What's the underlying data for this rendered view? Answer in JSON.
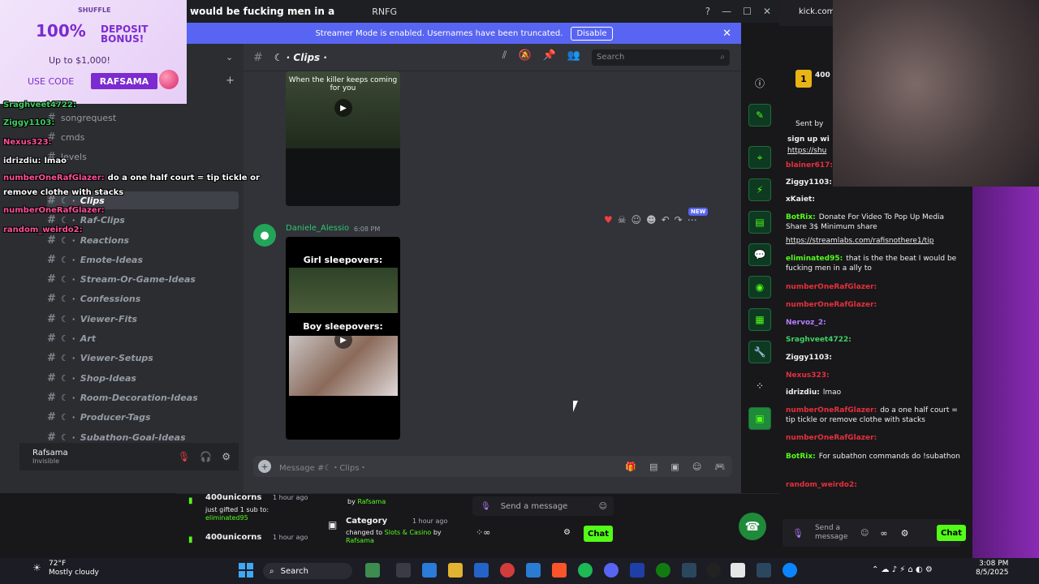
{
  "window": {
    "title": "would be fucking men in a",
    "app_name": "RNFG"
  },
  "banner": {
    "text": "Streamer Mode is enabled. Usernames have been truncated.",
    "disable_label": "Disable"
  },
  "ad": {
    "brand": "SHUFFLE",
    "headline": "100%",
    "headline2": "DEPOSIT BONUS!",
    "upto": "Up to $1,000!",
    "use_code": "USE CODE",
    "code": "RAFSAMA"
  },
  "sidebar": {
    "channels": [
      {
        "name": "songrequest",
        "style": "plain"
      },
      {
        "name": "cmds",
        "style": "plain"
      },
      {
        "name": "levels",
        "style": "plain"
      },
      {
        "name": "Clips",
        "style": "active"
      },
      {
        "name": "Raf-Clips",
        "style": "italic"
      },
      {
        "name": "Reactions",
        "style": "italic"
      },
      {
        "name": "Emote-Ideas",
        "style": "italic"
      },
      {
        "name": "Stream-Or-Game-Ideas",
        "style": "italic"
      },
      {
        "name": "Confessions",
        "style": "italic"
      },
      {
        "name": "Viewer-Fits",
        "style": "italic"
      },
      {
        "name": "Art",
        "style": "italic"
      },
      {
        "name": "Viewer-Setups",
        "style": "italic"
      },
      {
        "name": "Shop-Ideas",
        "style": "italic"
      },
      {
        "name": "Room-Decoration-Ideas",
        "style": "italic"
      },
      {
        "name": "Producer-Tags",
        "style": "italic"
      },
      {
        "name": "Subathon-Goal-Ideas",
        "style": "italic"
      }
    ],
    "user": {
      "name": "Rafsama",
      "status": "Invisible"
    }
  },
  "channel": {
    "name": "Clips",
    "search_placeholder": "Search",
    "composer_placeholder": "Message #☾・Clips・"
  },
  "messages": {
    "video1_caption": "When the killer keeps coming for you",
    "author": "Daniele_Alessio",
    "time": "6:08 PM",
    "video2_label_top": "Girl sleepovers:",
    "video2_label_bottom": "Boy sleepovers:",
    "new_badge": "NEW"
  },
  "overlay_chat": [
    {
      "user": "Sraghveet4722:",
      "text": "",
      "color": "green"
    },
    {
      "user": "Ziggy1103:",
      "text": "",
      "color": "green"
    },
    {
      "user": "Nexus323:",
      "text": "",
      "color": "pink"
    },
    {
      "user": "idrizdiu:",
      "text": "lmao",
      "color": "white"
    },
    {
      "user": "numberOneRafGlazer:",
      "text": "do a one half court = tip tickle or",
      "color": "pink"
    },
    {
      "user": "",
      "text": "remove clothe with stacks",
      "color": "white"
    },
    {
      "user": "numberOneRafGlazer:",
      "text": "",
      "color": "pink"
    },
    {
      "user": "random_weirdo2:",
      "text": "",
      "color": "pink"
    }
  ],
  "kick_chat": [
    {
      "user": "blainer617:",
      "text": "",
      "ucolor": "red"
    },
    {
      "user": "Ziggy1103:",
      "text": "",
      "ucolor": "white"
    },
    {
      "user": "xKaiet:",
      "text": "",
      "ucolor": "white"
    },
    {
      "user": "BotRix:",
      "text": "Donate For Video To Pop Up Media Share 3$ Minimum share",
      "ucolor": "lime"
    },
    {
      "user": "",
      "text": "https://streamlabs.com/rafisnothere1/tip",
      "ucolor": "white"
    },
    {
      "user": "eliminated95:",
      "text": "that is the the beat I would be fucking men in a ally to",
      "ucolor": "lime"
    },
    {
      "user": "numberOneRafGlazer:",
      "text": "",
      "ucolor": "red"
    },
    {
      "user": "numberOneRafGlazer:",
      "text": "",
      "ucolor": "red"
    },
    {
      "user": "Nervoz_2:",
      "text": "",
      "ucolor": "lav"
    },
    {
      "user": "Sraghveet4722:",
      "text": "",
      "ucolor": "green"
    },
    {
      "user": "Ziggy1103:",
      "text": "",
      "ucolor": "white"
    },
    {
      "user": "Nexus323:",
      "text": "",
      "ucolor": "red"
    },
    {
      "user": "idrizdiu:",
      "text": "lmao",
      "ucolor": "white"
    },
    {
      "user": "numberOneRafGlazer:",
      "text": "do a one half court = tip tickle or remove clothe with stacks",
      "ucolor": "red"
    },
    {
      "user": "numberOneRafGlazer:",
      "text": "",
      "ucolor": "red"
    },
    {
      "user": "BotRix:",
      "text": "For subathon commands do !subathon",
      "ucolor": "lime"
    },
    {
      "user": "random_weirdo2:",
      "text": "",
      "ucolor": "red"
    }
  ],
  "kick_top": {
    "url": "kick.com",
    "sent_by": "Sent by",
    "signup": "sign up wi",
    "link": "https://shu",
    "number": "400"
  },
  "kick_input": {
    "placeholder": "Send a message",
    "chat_label": "Chat"
  },
  "dash": {
    "gift_user": "400unicorns",
    "gift_time": "1 hour ago",
    "gift_text": "just gifted 1 sub to:",
    "gift_target": "eliminated95",
    "user2": "400unicorns",
    "time2": "1 hour ago",
    "by_label": "by",
    "by_user": "Rafsama",
    "category_title": "Category",
    "category_time": "1 hour ago",
    "category_text": "changed to",
    "category_value": "Slots & Casino",
    "category_by": "Rafsama",
    "send_placeholder": "Send a message",
    "chat_label": "Chat"
  },
  "taskbar": {
    "temp": "72°F",
    "weather": "Mostly cloudy",
    "search": "Search",
    "time": "3:08 PM",
    "date": "8/5/2025"
  }
}
